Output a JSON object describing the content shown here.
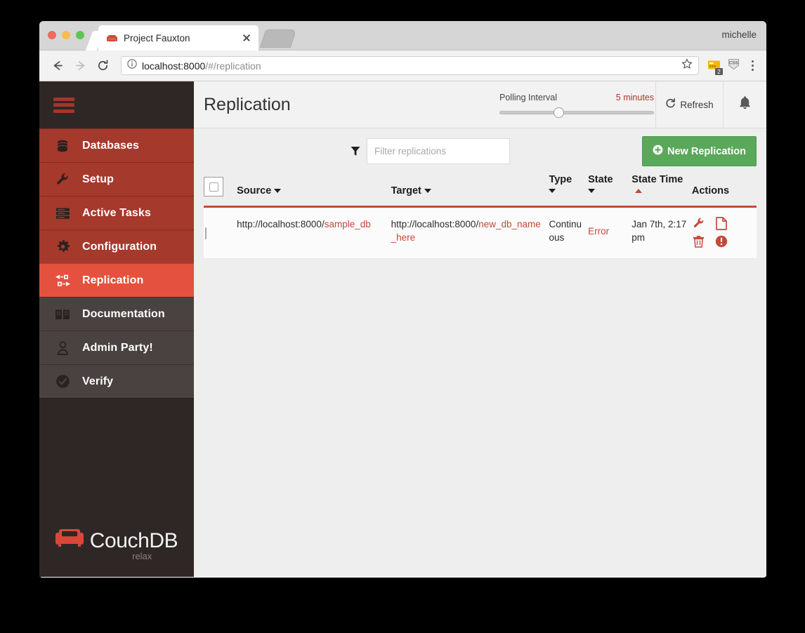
{
  "browser": {
    "tab_title": "Project Fauxton",
    "tab_favicon_name": "couchdb-favicon",
    "user_label": "michelle",
    "url_prefix": "localhost:8000",
    "url_suffix": "/#/replication",
    "extension_badge_count": "2",
    "extension_css_label": "CSS"
  },
  "sidebar": {
    "items": [
      {
        "label": "Databases",
        "icon": "database-icon",
        "style": "red"
      },
      {
        "label": "Setup",
        "icon": "wrench-icon",
        "style": "red"
      },
      {
        "label": "Active Tasks",
        "icon": "tasks-icon",
        "style": "red"
      },
      {
        "label": "Configuration",
        "icon": "gear-icon",
        "style": "red"
      },
      {
        "label": "Replication",
        "icon": "replication-icon",
        "style": "active"
      },
      {
        "label": "Documentation",
        "icon": "book-icon",
        "style": "dark"
      },
      {
        "label": "Admin Party!",
        "icon": "person-icon",
        "style": "dark"
      },
      {
        "label": "Verify",
        "icon": "check-circle-icon",
        "style": "dark"
      }
    ],
    "logo_word": "CouchDB",
    "logo_tagline": "relax"
  },
  "header": {
    "title": "Replication",
    "polling_label": "Polling Interval",
    "polling_value": "5 minutes",
    "polling_slider_percent": 38,
    "refresh_label": "Refresh",
    "bell_icon": "bell-icon"
  },
  "toolbar": {
    "filter_placeholder": "Filter replications",
    "filter_value": "",
    "new_replication_label": "New Replication"
  },
  "table": {
    "columns": {
      "source": "Source",
      "target": "Target",
      "type": "Type",
      "state": "State",
      "state_time": "State Time",
      "actions": "Actions"
    },
    "sorted_column": "state_time",
    "sort_direction": "asc",
    "rows": [
      {
        "source_prefix": "http://localhost:8000/",
        "source_db": "sample_db",
        "target_prefix": "http://localhost:8000/",
        "target_db": "new_db_name_here",
        "type": "Continuous",
        "state": "Error",
        "state_time": "Jan 7th, 2:17 pm",
        "actions": [
          "wrench-icon",
          "document-icon",
          "trash-icon",
          "error-circle-icon"
        ]
      }
    ]
  },
  "colors": {
    "brand_red": "#c4493a",
    "sidebar_red": "#a5392c",
    "sidebar_active_red": "#e4513e",
    "sidebar_dark": "#2f2725",
    "sidebar_item_dark": "#4a4240",
    "green_button": "#5aa85a"
  }
}
